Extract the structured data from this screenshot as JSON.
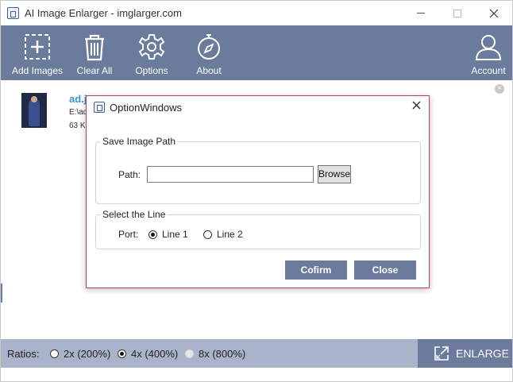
{
  "window": {
    "title": "AI Image Enlarger - imglarger.com"
  },
  "toolbar": {
    "items": [
      {
        "label": "Add Images",
        "icon": "add-image-icon"
      },
      {
        "label": "Clear All",
        "icon": "trash-icon"
      },
      {
        "label": "Options",
        "icon": "gear-icon"
      },
      {
        "label": "About",
        "icon": "compass-icon"
      }
    ],
    "account": {
      "label": "Account",
      "icon": "user-icon"
    }
  },
  "file_list": [
    {
      "name": "ad.j",
      "path": "E:\\ad",
      "size": "63 K"
    }
  ],
  "bottom": {
    "ratios_label": "Ratios:",
    "options": [
      {
        "label": "2x (200%)",
        "checked": false,
        "disabled": false
      },
      {
        "label": "4x (400%)",
        "checked": true,
        "disabled": false
      },
      {
        "label": "8x (800%)",
        "checked": false,
        "disabled": true
      }
    ],
    "enlarge_label": "ENLARGE"
  },
  "dialog": {
    "title": "OptionWindows",
    "save_group": {
      "legend": "Save Image Path",
      "path_label": "Path:",
      "path_value": "",
      "browse_label": "Browse"
    },
    "line_group": {
      "legend": "Select the Line",
      "port_label": "Port:",
      "options": [
        {
          "label": "Line 1",
          "checked": true
        },
        {
          "label": "Line 2",
          "checked": false
        }
      ]
    },
    "confirm_label": "Cofirm",
    "close_label": "Close"
  },
  "colors": {
    "toolbar_bg": "#6b7b9c",
    "bottom_bg": "#a9b4ca",
    "filename": "#3d8fd6",
    "dialog_border": "#c23a6b"
  }
}
